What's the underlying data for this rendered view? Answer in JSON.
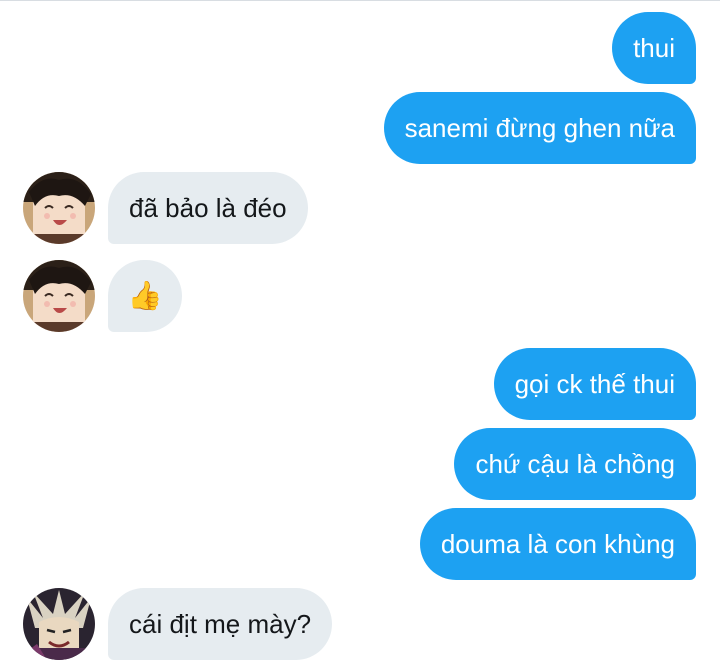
{
  "conversation": {
    "messages": [
      {
        "side": "outgoing",
        "text": "thui"
      },
      {
        "side": "outgoing",
        "text": "sanemi đừng ghen nữa"
      },
      {
        "side": "incoming",
        "text": "đã bảo là đéo"
      },
      {
        "side": "incoming",
        "text": "👍"
      },
      {
        "side": "outgoing",
        "text": "gọi ck thế thui"
      },
      {
        "side": "outgoing",
        "text": "chứ cậu là chồng"
      },
      {
        "side": "outgoing",
        "text": "douma là con khùng"
      },
      {
        "side": "incoming",
        "text": "cái địt mẹ mày?"
      }
    ]
  },
  "colors": {
    "outgoing_bubble": "#1da1f2",
    "incoming_bubble": "#e6ecf0",
    "outgoing_text": "#ffffff",
    "incoming_text": "#14171a"
  },
  "icons": {
    "avatar_1": "anime-avatar-laughing",
    "avatar_2": "anime-avatar-laughing",
    "avatar_3": "anime-avatar-dark"
  }
}
